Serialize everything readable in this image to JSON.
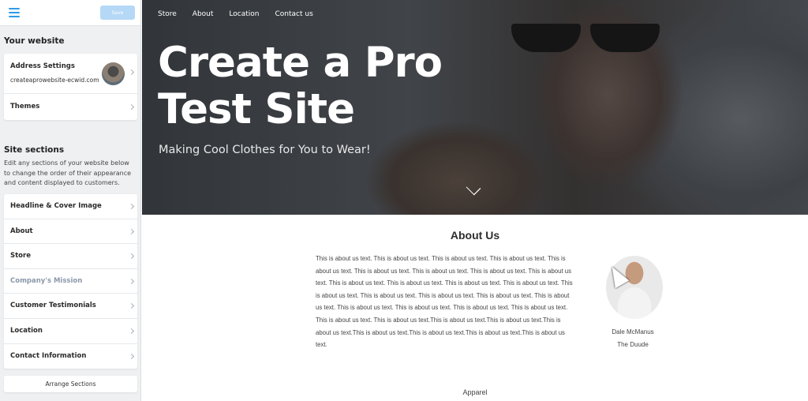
{
  "sidebar": {
    "menu_icon": "hamburger-icon",
    "save_label": "Save",
    "your_website_title": "Your website",
    "address_settings": {
      "label": "Address Settings",
      "url": "createaprowebsite-ecwid.com"
    },
    "themes_label": "Themes",
    "site_sections_title": "Site sections",
    "site_sections_desc": "Edit any sections of your website below to change the order of their appearance and content displayed to customers.",
    "sections": [
      {
        "label": "Headline & Cover Image",
        "dim": false
      },
      {
        "label": "About",
        "dim": false
      },
      {
        "label": "Store",
        "dim": false
      },
      {
        "label": "Company's Mission",
        "dim": true
      },
      {
        "label": "Customer Testimonials",
        "dim": false
      },
      {
        "label": "Location",
        "dim": false
      },
      {
        "label": "Contact Information",
        "dim": false
      }
    ],
    "arrange_label": "Arrange Sections"
  },
  "preview": {
    "nav": [
      "Store",
      "About",
      "Location",
      "Contact us"
    ],
    "headline": "Create a Pro Test Site",
    "tagline": "Making Cool Clothes for You to Wear!",
    "about": {
      "title": "About Us",
      "text": "This is about us text. This is about us text. This is about us text. This is about us text. This is about us text. This is about us text. This is about us text. This is about us text. This is about us text. This is about us text. This is about us text. This is about us text. This is about us text. This is about us text. This is about us text. This is about us text. This is about us text. This is about us text. This is about us text. This is about us text. This is about us text. This is about us text. This is about us text. This is about us text.This is about us text.This is about us text.This is about us text.This is about us text.This is about us text.This is about us text.This is about us text.",
      "person_name": "Dale McManus",
      "person_title": "The Duude"
    },
    "next_section": "Apparel"
  }
}
